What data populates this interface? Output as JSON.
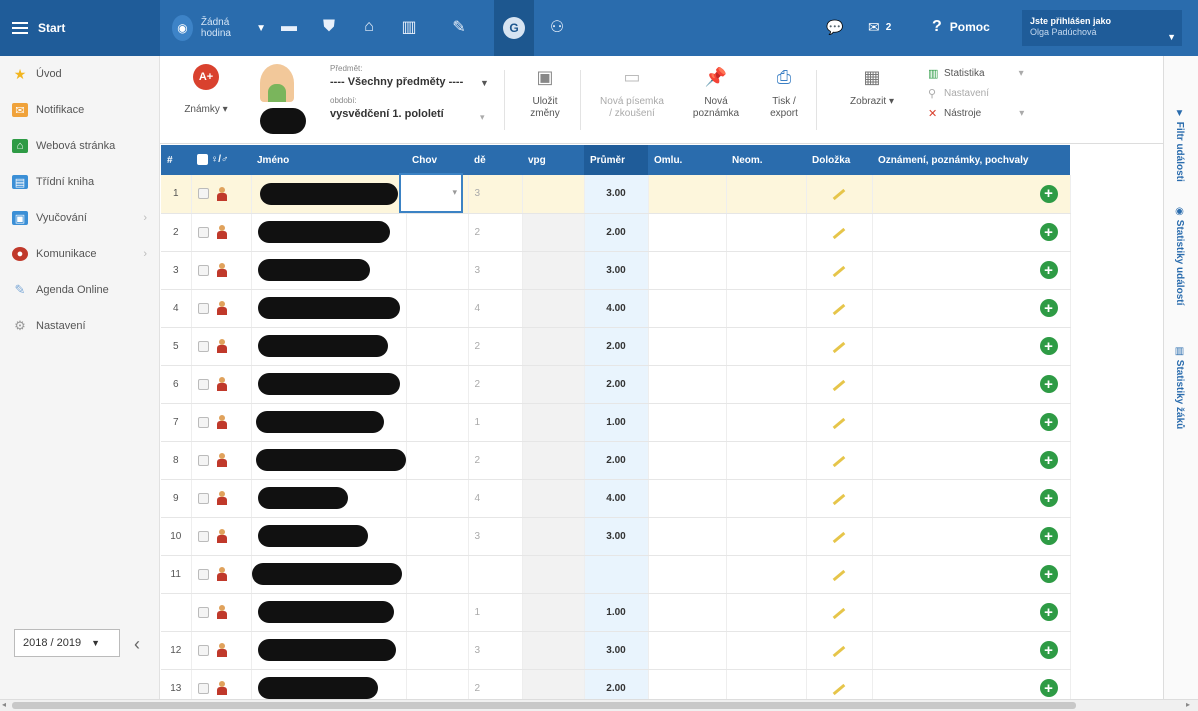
{
  "topbar": {
    "start_label": "Start",
    "hodina_label": "Žádná hodina",
    "help_label": "Pomoc",
    "messages_count": "2",
    "user_role": "Jste přihlášen jako",
    "user_name": "Olga Padúchová"
  },
  "sidebar": {
    "items": [
      {
        "label": "Úvod",
        "icon": "star-icon",
        "color": "#f2b51f"
      },
      {
        "label": "Notifikace",
        "icon": "envelope-icon",
        "color": "#f0a23a"
      },
      {
        "label": "Webová stránka",
        "icon": "home-icon",
        "color": "#2e9b45"
      },
      {
        "label": "Třídní kniha",
        "icon": "book-icon",
        "color": "#3b8fd6"
      },
      {
        "label": "Vyučování",
        "icon": "classroom-icon",
        "color": "#3b8fd6"
      },
      {
        "label": "Komunikace",
        "icon": "chat-icon",
        "color": "#c0392b"
      },
      {
        "label": "Agenda Online",
        "icon": "pen-icon",
        "color": "#7aa7d6"
      },
      {
        "label": "Nastavení",
        "icon": "gear-icon",
        "color": "#999999"
      }
    ],
    "school_year": "2018 / 2019"
  },
  "toolbar": {
    "znamky_label": "Známky",
    "subject_label": "Předmět:",
    "subject_value": "---- Všechny předměty ----",
    "period_label": "období:",
    "period_value": "vysvědčení 1. pololetí",
    "save_label_1": "Uložit",
    "save_label_2": "změny",
    "new_test_label_1": "Nová písemka",
    "new_test_label_2": "/ zkoušení",
    "new_note_label_1": "Nová",
    "new_note_label_2": "poznámka",
    "print_label_1": "Tisk /",
    "print_label_2": "export",
    "show_label": "Zobrazit",
    "menu_statistika": "Statistika",
    "menu_nastaveni": "Nastavení",
    "menu_nastroje": "Nástroje"
  },
  "rail": {
    "filter": "Filtr události",
    "stats_events": "Statistiky událostí",
    "stats_students": "Statistiky žáků"
  },
  "grid": {
    "headers": {
      "num": "#",
      "sex": "♀/♂",
      "name": "Jméno",
      "chov": "Chov",
      "dv": "dě",
      "vpg": "vpg",
      "avg": "Průměr",
      "omlu": "Omlu.",
      "neom": "Neom.",
      "dolozka": "Doložka",
      "notes": "Oznámení, poznámky, pochvaly"
    },
    "rows": [
      {
        "num": "1",
        "dv": "3",
        "avg": "3.00"
      },
      {
        "num": "2",
        "dv": "2",
        "avg": "2.00"
      },
      {
        "num": "3",
        "dv": "3",
        "avg": "3.00"
      },
      {
        "num": "4",
        "dv": "4",
        "avg": "4.00"
      },
      {
        "num": "5",
        "dv": "2",
        "avg": "2.00"
      },
      {
        "num": "6",
        "dv": "2",
        "avg": "2.00"
      },
      {
        "num": "7",
        "dv": "1",
        "avg": "1.00"
      },
      {
        "num": "8",
        "dv": "2",
        "avg": "2.00"
      },
      {
        "num": "9",
        "dv": "4",
        "avg": "4.00"
      },
      {
        "num": "10",
        "dv": "3",
        "avg": "3.00"
      },
      {
        "num": "11",
        "dv": "",
        "avg": ""
      },
      {
        "num": "",
        "dv": "1",
        "avg": "1.00"
      },
      {
        "num": "12",
        "dv": "3",
        "avg": "3.00"
      },
      {
        "num": "13",
        "dv": "2",
        "avg": "2.00"
      }
    ]
  }
}
